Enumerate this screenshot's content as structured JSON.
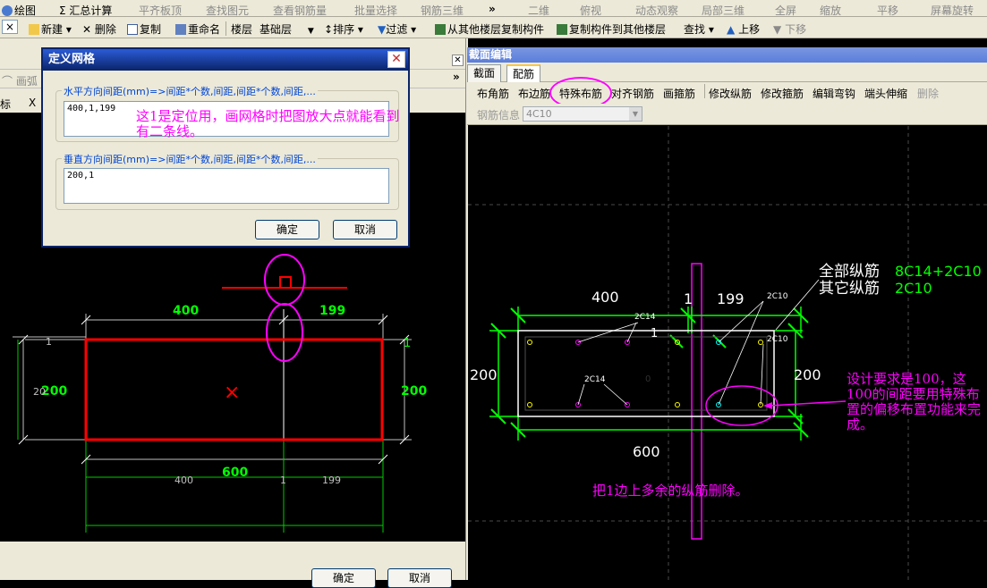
{
  "colors": {
    "bg_dark": "#000000",
    "toolbar_bg": "#ece9d8",
    "dialog_title": "#0a246a",
    "accent_magenta": "#ff00ff",
    "green": "#00ff00",
    "red": "#ff0000",
    "cyan": "#00ffff",
    "yellow": "#ffff00",
    "white": "#ffffff"
  },
  "toolbar_top": {
    "items": [
      "绘图",
      "Σ 汇总计算",
      "平齐板顶",
      "查找图元",
      "查看钢筋量",
      "批量选择",
      "钢筋三维",
      "二维",
      "俯视",
      "动态观察",
      "局部三维",
      "全屏",
      "缩放",
      "平移",
      "屏幕旋转"
    ]
  },
  "toolbar2": {
    "new": "新建",
    "delete": "删除",
    "copy": "复制",
    "rename": "重命名",
    "floor": "楼层",
    "floor_value": "基础层",
    "sort": "排序",
    "filter": "过滤",
    "copy_from_floor": "从其他楼层复制构件",
    "copy_to_floor": "复制构件到其他楼层",
    "find": "查找",
    "up": "上移",
    "down": "下移"
  },
  "left_panel": {
    "row_labels": [
      "画弧",
      "标",
      "X"
    ],
    "drawing_texts": {
      "dim_400": "400",
      "dim_199": "199",
      "dim_200_left": "200",
      "dim_200_overlap": "20",
      "dim_200_right": "200",
      "dim_600": "600",
      "bottom_400": "400",
      "bottom_1": "1",
      "bottom_199": "199",
      "mark_1_left": "1",
      "mark_1_right": "1",
      "mark_x": "×"
    },
    "bottom_buttons": [
      "确定",
      "取消"
    ]
  },
  "dialog": {
    "title": "定义网格",
    "horizontal_label": "水平方向间距(mm)=>间距*个数,间距,间距*个数,间距,...",
    "horizontal_value": "400,1,199",
    "vertical_label": "垂直方向间距(mm)=>间距*个数,间距,间距*个数,间距,...",
    "vertical_value": "200,1",
    "ok": "确定",
    "cancel": "取消"
  },
  "annotation_left": "这1是定位用，画网格时把图放大点就能看到有二条线。",
  "section_editor": {
    "title": "截面编辑",
    "tabs": [
      "截面",
      "配筋"
    ],
    "toolbar_items": [
      "布角筋",
      "布边筋",
      "特殊布筋",
      "对齐钢筋",
      "画箍筋",
      "修改纵筋",
      "修改箍筋",
      "编辑弯钩",
      "端头伸缩",
      "删除"
    ],
    "rebar_info_label": "钢筋信息",
    "rebar_info_value": "4C10",
    "drawing_texts": {
      "dim_400": "400",
      "dim_1": "1",
      "dim_199": "199",
      "dim_200_left": "200",
      "dim_200_right": "200",
      "dim_600": "600",
      "label_2c14_top": "2C14",
      "label_2c14_mid": "2C14",
      "label_2c10_top": "2C10",
      "label_2c10_right": "2C10",
      "label_1": "1",
      "label_0": "0",
      "all_longitudinal_label": "全部纵筋",
      "all_longitudinal_value": "8C14+2C10",
      "other_longitudinal_label": "其它纵筋",
      "other_longitudinal_value": "2C10"
    },
    "annotation_right": "设计要求是100，这100的间距要用特殊布置的偏移布置功能来完成。",
    "annotation_bottom": "把1边上多余的纵筋删除。"
  }
}
